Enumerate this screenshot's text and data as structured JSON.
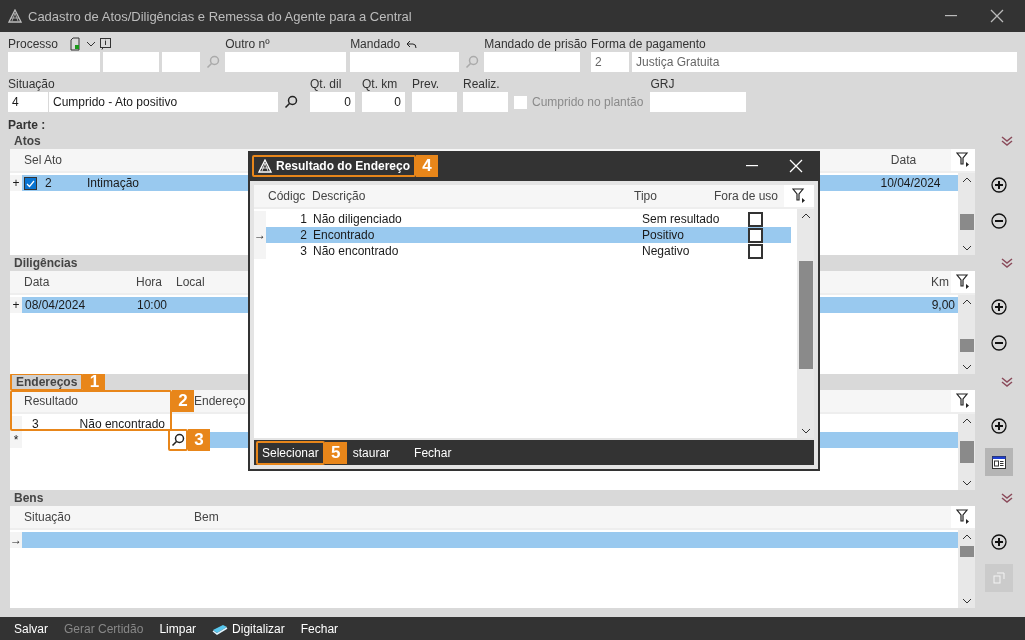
{
  "window": {
    "title": "Cadastro de Atos/Diligências e Remessa do Agente para a Central"
  },
  "form": {
    "processo_label": "Processo",
    "outro_label": "Outro nº",
    "mandado_label": "Mandado",
    "mandado_prisao_label": "Mandado de prisão",
    "pagamento_label": "Forma de pagamento",
    "pagamento_code": "2",
    "pagamento_value": "Justiça Gratuita",
    "situacao_label": "Situação",
    "situacao_code": "4",
    "situacao_value": "Cumprido - Ato positivo",
    "qt_dil_label": "Qt. dil",
    "qt_dil": "0",
    "qt_km_label": "Qt. km",
    "qt_km": "0",
    "prev_label": "Prev.",
    "realiz_label": "Realiz.",
    "plantao": {
      "label": "Cumprido no plantão",
      "checked": false,
      "disabled": true
    },
    "grj_label": "GRJ",
    "parte_label": "Parte :"
  },
  "sections": [
    {
      "kind": "atos",
      "title": "Atos",
      "columns": [
        "Sel",
        "Ato",
        "",
        "Data"
      ],
      "rows": [
        {
          "marker": "+",
          "checked": true,
          "selected": true,
          "cells": [
            "",
            "2",
            "Intimação",
            "10/04/2024"
          ]
        }
      ],
      "side_buttons": [
        {
          "kind": "add",
          "disabled": false
        },
        {
          "kind": "remove",
          "disabled": false
        }
      ]
    },
    {
      "kind": "diligencias",
      "title": "Diligências",
      "columns": [
        "Data",
        "Hora",
        "Local",
        "Km"
      ],
      "rows": [
        {
          "marker": "+",
          "selected": true,
          "cells": [
            "08/04/2024",
            "10:00",
            "",
            "9,00"
          ]
        }
      ],
      "side_buttons": [
        {
          "kind": "add",
          "disabled": false
        },
        {
          "kind": "remove",
          "disabled": false
        }
      ]
    },
    {
      "kind": "enderecos",
      "title": "Endereços",
      "columns": [
        "Resultado",
        "Endereço"
      ],
      "rows": [
        {
          "selected": false,
          "cells": [
            "3",
            "Não encontrado"
          ]
        },
        {
          "marker": "*",
          "selected": true
        }
      ],
      "side_buttons": [
        {
          "kind": "add",
          "disabled": false
        },
        {
          "kind": "form",
          "disabled": false
        }
      ]
    },
    {
      "kind": "bens",
      "title": "Bens",
      "columns": [
        "Situação",
        "Bem"
      ],
      "rows": [
        {
          "marker": "→",
          "selected": true
        }
      ],
      "side_buttons": [
        {
          "kind": "add",
          "disabled": false
        },
        {
          "kind": "layout",
          "disabled": true
        }
      ]
    }
  ],
  "dialog": {
    "title": "Resultado do Endereço",
    "columns": [
      "Códigc",
      "Descrição",
      "Tipo",
      "Fora de uso"
    ],
    "rows": [
      {
        "code": "1",
        "description": "Não diligenciado",
        "type": "Sem resultado",
        "out_of_use": false,
        "selected": false
      },
      {
        "marker": "→",
        "code": "2",
        "description": "Encontrado",
        "type": "Positivo",
        "out_of_use": false,
        "selected": true
      },
      {
        "code": "3",
        "description": "Não encontrado",
        "type": "Negativo",
        "out_of_use": false,
        "selected": false
      }
    ],
    "buttons": [
      "Selecionar",
      "staurar",
      "Fechar"
    ]
  },
  "toolbar": [
    {
      "label": "Salvar",
      "disabled": false
    },
    {
      "label": "Gerar Certidão",
      "disabled": true
    },
    {
      "label": "Limpar",
      "disabled": false
    },
    {
      "label": "Digitalizar",
      "disabled": false,
      "kind": "scan"
    },
    {
      "label": "Fechar",
      "disabled": false
    }
  ],
  "callouts": [
    "1",
    "2",
    "3",
    "4",
    "5"
  ]
}
